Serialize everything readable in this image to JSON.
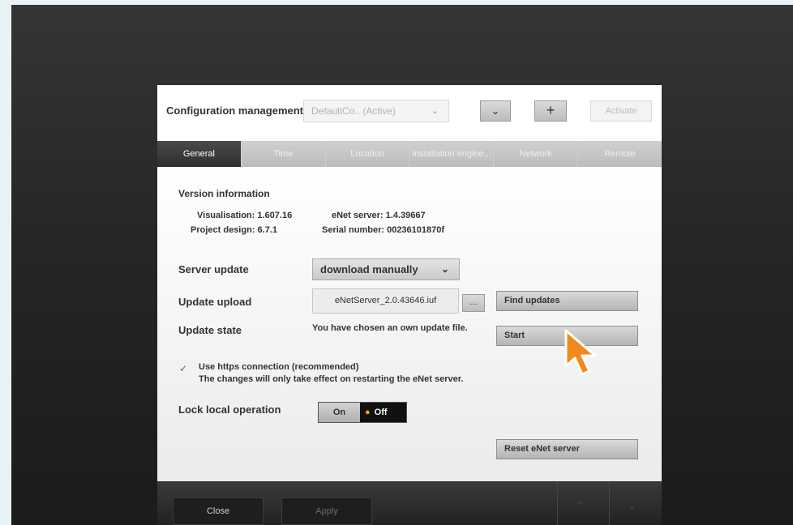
{
  "config": {
    "label": "Configuration management",
    "selected": "DefaultCo.. (Active)",
    "add_symbol": "+",
    "activate": "Activate"
  },
  "tabs": [
    "General",
    "Time",
    "Location",
    "Installation engine...",
    "Network",
    "Remote"
  ],
  "version": {
    "title": "Version information",
    "visualisation": "Visualisation: 1.607.16",
    "project": "Project design: 6.7.1",
    "enet_server": "eNet server: 1.4.39667",
    "serial": "Serial number: 00236101870f"
  },
  "server_update": {
    "label": "Server update",
    "value": "download manually"
  },
  "update_upload": {
    "label": "Update upload",
    "file": "eNetServer_2.0.43646.iuf",
    "browse": "..."
  },
  "buttons": {
    "find_updates": "Find updates",
    "start": "Start",
    "reset": "Reset eNet server"
  },
  "update_state": {
    "label": "Update state",
    "value": "You have chosen an own update file."
  },
  "https": {
    "checked": true,
    "label": "Use https connection (recommended)",
    "note": "The changes will only take effect on restarting the eNet server."
  },
  "lock": {
    "label": "Lock local operation",
    "on": "On",
    "off": "Off",
    "selected": "Off"
  },
  "footer": {
    "close": "Close",
    "apply": "Apply"
  },
  "colors": {
    "accent": "#f08a1c",
    "dark": "#2e2e2e"
  }
}
